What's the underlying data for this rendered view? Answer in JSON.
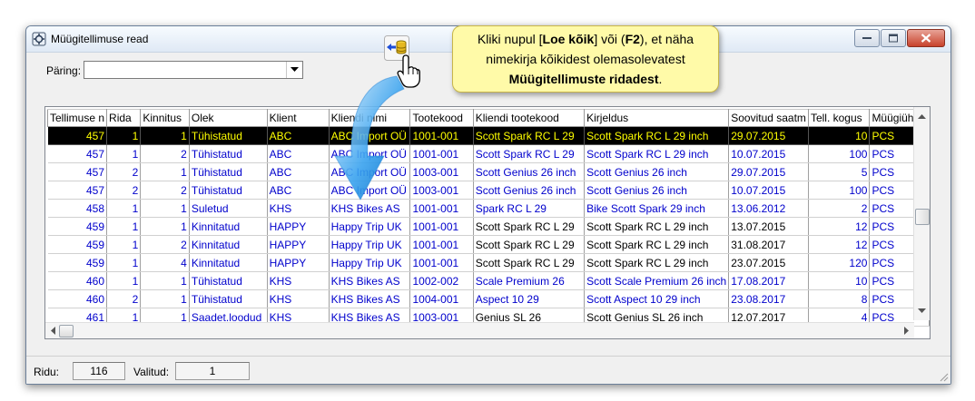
{
  "window": {
    "title": "Müügitellimuse read"
  },
  "query": {
    "label": "Päring:",
    "value": ""
  },
  "callout": {
    "line1_pre": "Kliki nupul [",
    "line1_bold1": "Loe kõik",
    "line1_mid": "] või (",
    "line1_bold2": "F2",
    "line1_post": "), et näha",
    "line2": "nimekirja kõikidest olemasolevatest",
    "line3_bold": "Müügitellimuste ridadest",
    "line3_post": "."
  },
  "grid": {
    "columns": [
      "Tellimuse n",
      "Rida",
      "Kinnitus",
      "Olek",
      "Klient",
      "Kliendi nimi",
      "Tootekood",
      "Kliendi tootekood",
      "Kirjeldus",
      "Soovitud saatm",
      "Tell. kogus",
      "Müügiühik"
    ],
    "rows": [
      [
        "457",
        "1",
        "1",
        "Tühistatud",
        "ABC",
        "ABC Import OÜ",
        "1001-001",
        "Scott Spark RC L 29",
        "Scott Spark RC L 29 inch",
        "29.07.2015",
        "10",
        "PCS"
      ],
      [
        "457",
        "1",
        "2",
        "Tühistatud",
        "ABC",
        "ABC Import OÜ",
        "1001-001",
        "Scott Spark RC L 29",
        "Scott Spark RC L 29 inch",
        "10.07.2015",
        "100",
        "PCS"
      ],
      [
        "457",
        "2",
        "1",
        "Tühistatud",
        "ABC",
        "ABC Import OÜ",
        "1003-001",
        "Scott Genius 26 inch",
        "Scott Genius 26 inch",
        "29.07.2015",
        "5",
        "PCS"
      ],
      [
        "457",
        "2",
        "2",
        "Tühistatud",
        "ABC",
        "ABC Import OÜ",
        "1003-001",
        "Scott Genius 26 inch",
        "Scott Genius 26 inch",
        "10.07.2015",
        "100",
        "PCS"
      ],
      [
        "458",
        "1",
        "1",
        "Suletud",
        "KHS",
        "KHS Bikes AS",
        "1001-001",
        "Spark RC L 29",
        "Bike Scott Spark 29 inch",
        "13.06.2012",
        "2",
        "PCS"
      ],
      [
        "459",
        "1",
        "1",
        "Kinnitatud",
        "HAPPY",
        "Happy Trip UK",
        "1001-001",
        "Scott Spark RC L 29",
        "Scott Spark RC L 29 inch",
        "13.07.2015",
        "12",
        "PCS"
      ],
      [
        "459",
        "1",
        "2",
        "Kinnitatud",
        "HAPPY",
        "Happy Trip UK",
        "1001-001",
        "Scott Spark RC L 29",
        "Scott Spark RC L 29 inch",
        "31.08.2017",
        "12",
        "PCS"
      ],
      [
        "459",
        "1",
        "4",
        "Kinnitatud",
        "HAPPY",
        "Happy Trip UK",
        "1001-001",
        "Scott Spark RC L 29",
        "Scott Spark RC L 29 inch",
        "23.07.2015",
        "120",
        "PCS"
      ],
      [
        "460",
        "1",
        "1",
        "Tühistatud",
        "KHS",
        "KHS Bikes AS",
        "1002-002",
        "Scale Premium 26",
        "Scott Scale Premium 26 inch",
        "17.08.2017",
        "10",
        "PCS"
      ],
      [
        "460",
        "2",
        "1",
        "Tühistatud",
        "KHS",
        "KHS Bikes AS",
        "1004-001",
        "Aspect 10 29",
        "Scott Aspect 10 29 inch",
        "23.08.2017",
        "8",
        "PCS"
      ],
      [
        "461",
        "1",
        "1",
        "Saadet.loodud",
        "KHS",
        "KHS Bikes AS",
        "1003-001",
        "Genius SL 26",
        "Scott Genius SL 26 inch",
        "12.07.2017",
        "4",
        "PCS"
      ]
    ],
    "black_cells": [
      [
        5,
        7
      ],
      [
        5,
        8
      ],
      [
        5,
        9
      ],
      [
        6,
        7
      ],
      [
        6,
        8
      ],
      [
        6,
        9
      ],
      [
        7,
        7
      ],
      [
        7,
        8
      ],
      [
        7,
        9
      ],
      [
        10,
        7
      ],
      [
        10,
        8
      ],
      [
        10,
        9
      ]
    ],
    "selected_row": 0
  },
  "status": {
    "rows_label": "Ridu:",
    "rows_value": "116",
    "selected_label": "Valitud:",
    "selected_value": "1"
  },
  "colors": {
    "selection_bg": "#000000",
    "selection_fg": "#ffff00",
    "data_blue": "#0000cc",
    "callout_bg": "#fffaa8",
    "arrow_blue": "#1a8fe0"
  }
}
